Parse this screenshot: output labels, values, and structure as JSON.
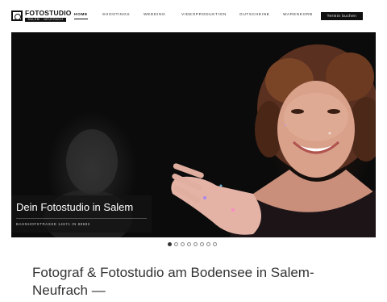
{
  "logo": {
    "title": "FOTOSTUDIO",
    "subtitle": "SALEM · NEUFRACH"
  },
  "nav": {
    "items": [
      {
        "label": "Home",
        "active": true
      },
      {
        "label": "Shootings",
        "active": false
      },
      {
        "label": "Wedding",
        "active": false
      },
      {
        "label": "Videoproduktion",
        "active": false
      },
      {
        "label": "Gutscheine",
        "active": false
      },
      {
        "label": "Warenkorb",
        "active": false
      }
    ],
    "cta_label": "Termin buchen"
  },
  "hero": {
    "title": "Dein Fotostudio in Salem",
    "subtitle": "Bahnhofstraße 14671 in 88682",
    "slides_total": 8,
    "active_slide": 1
  },
  "content": {
    "headline": "Fotograf & Fotostudio am Bodensee in Salem-Neufrach —"
  },
  "colors": {
    "cta_bg": "#111111",
    "caption_bg": "#141414",
    "text": "#333333"
  }
}
